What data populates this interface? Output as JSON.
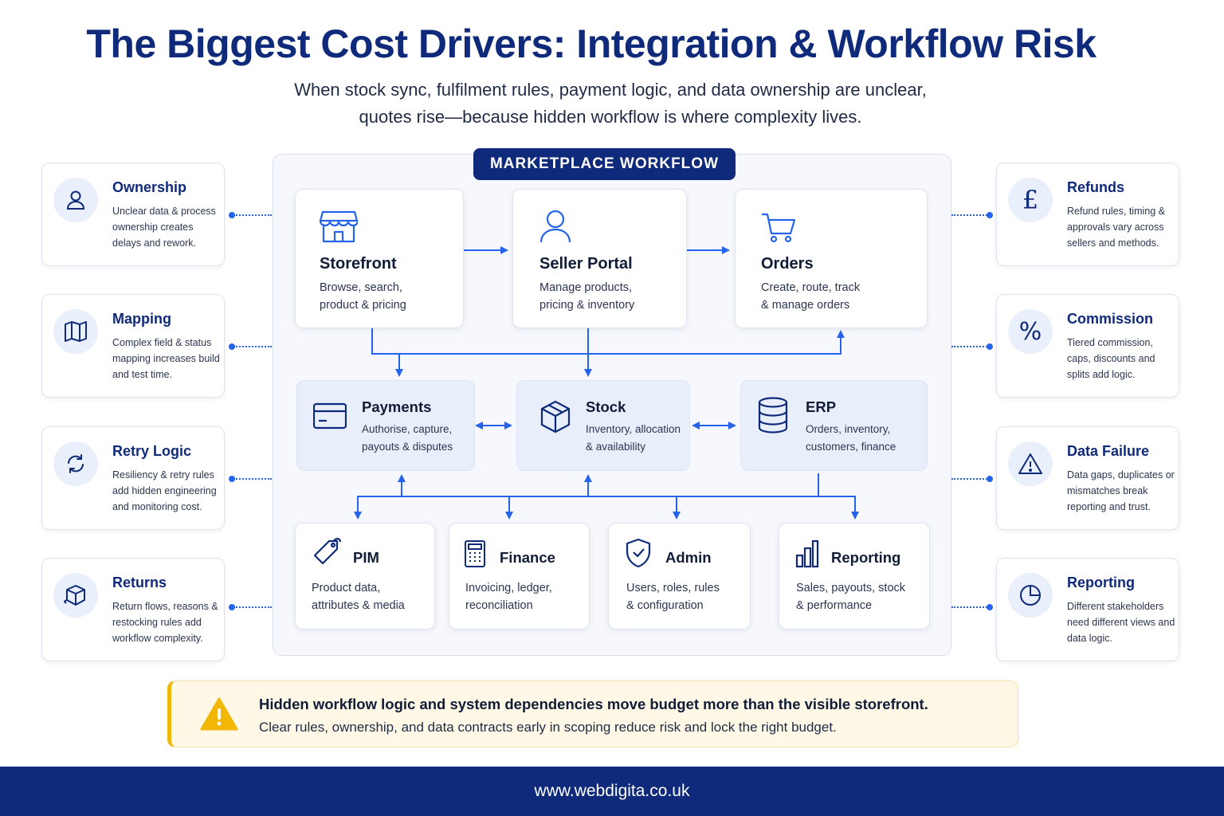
{
  "title": "The Biggest Cost Drivers: Integration & Workflow Risk",
  "subtitle": {
    "line1": "When stock sync, fulfilment rules, payment logic, and data ownership are unclear,",
    "line2": "quotes rise—because hidden workflow is where complexity lives."
  },
  "left_cards": [
    {
      "title": "Ownership",
      "desc": "Unclear data & process ownership creates delays and rework.",
      "icon": "user-icon"
    },
    {
      "title": "Mapping",
      "desc": "Complex field & status mapping increases build and test time.",
      "icon": "map-icon"
    },
    {
      "title": "Retry Logic",
      "desc": "Resiliency & retry rules add hidden engineering and monitoring cost.",
      "icon": "refresh-icon"
    },
    {
      "title": "Returns",
      "desc": "Return flows, reasons & restocking rules add workflow complexity.",
      "icon": "return-box-icon"
    }
  ],
  "right_cards": [
    {
      "title": "Refunds",
      "desc": "Refund rules, timing & approvals vary across sellers and methods.",
      "icon": "pound-icon"
    },
    {
      "title": "Commission",
      "desc": "Tiered commission, caps, discounts and splits add logic.",
      "icon": "percent-icon"
    },
    {
      "title": "Data Failure",
      "desc": "Data gaps, duplicates or mismatches break reporting and trust.",
      "icon": "warning-icon"
    },
    {
      "title": "Reporting",
      "desc": "Different stakeholders need different views and data logic.",
      "icon": "pie-chart-icon"
    }
  ],
  "workflow": {
    "label": "MARKETPLACE WORKFLOW",
    "top": [
      {
        "title": "Storefront",
        "desc1": "Browse, search,",
        "desc2": "product & pricing",
        "icon": "store-icon"
      },
      {
        "title": "Seller Portal",
        "desc1": "Manage products,",
        "desc2": "pricing & inventory",
        "icon": "person-icon"
      },
      {
        "title": "Orders",
        "desc1": "Create, route, track",
        "desc2": "& manage orders",
        "icon": "cart-icon"
      }
    ],
    "middle": [
      {
        "title": "Payments",
        "desc1": "Authorise, capture,",
        "desc2": "payouts & disputes",
        "icon": "card-icon"
      },
      {
        "title": "Stock",
        "desc1": "Inventory, allocation",
        "desc2": "& availability",
        "icon": "package-icon"
      },
      {
        "title": "ERP",
        "desc1": "Orders, inventory,",
        "desc2": "customers, finance",
        "icon": "database-icon"
      }
    ],
    "bottom": [
      {
        "title": "PIM",
        "desc1": "Product data,",
        "desc2": "attributes & media",
        "icon": "tag-icon"
      },
      {
        "title": "Finance",
        "desc1": "Invoicing, ledger,",
        "desc2": "reconciliation",
        "icon": "calculator-icon"
      },
      {
        "title": "Admin",
        "desc1": "Users, roles, rules",
        "desc2": "& configuration",
        "icon": "shield-check-icon"
      },
      {
        "title": "Reporting",
        "desc1": "Sales, payouts, stock",
        "desc2": "& performance",
        "icon": "bar-chart-icon"
      }
    ]
  },
  "banner": {
    "headline": "Hidden workflow logic and system dependencies move budget more than the visible storefront.",
    "body": "Clear rules, ownership, and data contracts early in scoping reduce risk and lock the right budget."
  },
  "footer": "www.webdigita.co.uk",
  "colors": {
    "navy": "#0f2a7a",
    "accent": "#2563eb",
    "warning": "#f2b705",
    "panel": "#f6f8fd"
  }
}
